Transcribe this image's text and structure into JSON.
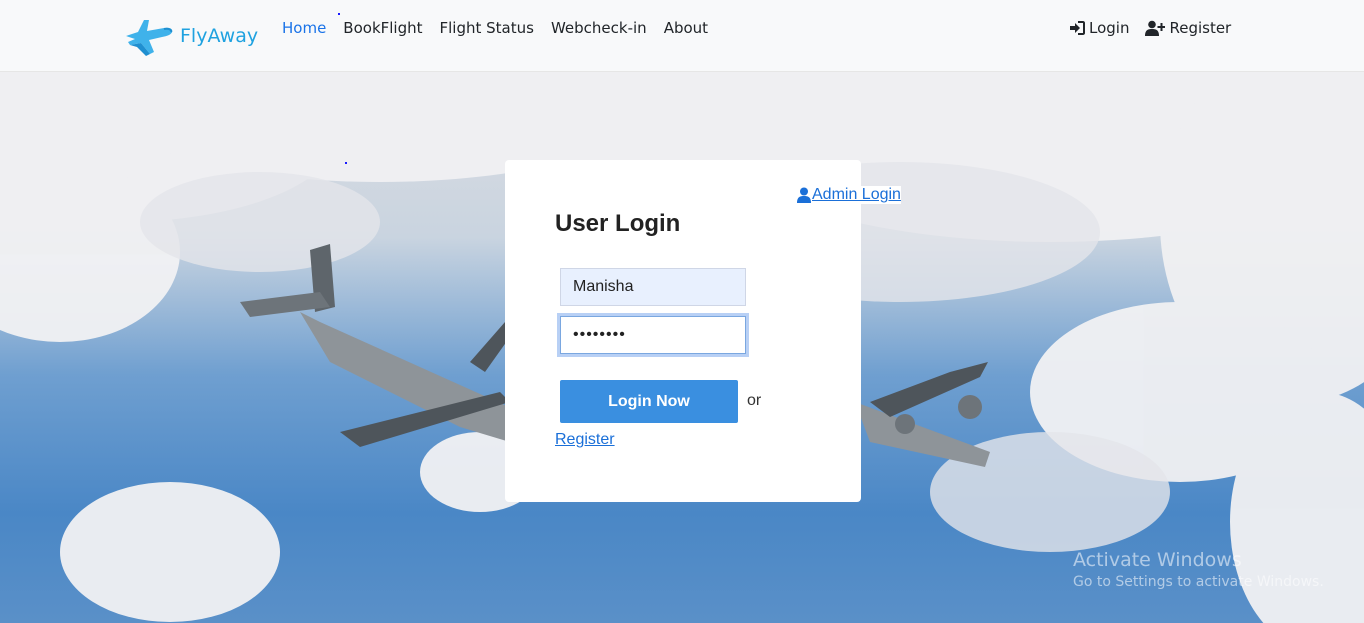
{
  "brand": {
    "name": "FlyAway",
    "icon": "airplane-logo"
  },
  "nav": {
    "links": [
      "Home",
      "BookFlight",
      "Flight Status",
      "Webcheck-in",
      "About"
    ],
    "active": "Home",
    "right": {
      "login_label": "Login",
      "register_label": "Register",
      "login_icon": "sign-in-icon",
      "register_icon": "user-plus-icon"
    }
  },
  "login_card": {
    "admin_link": "Admin Login",
    "admin_icon": "user-icon",
    "title": "User Login",
    "username_value": "Manisha",
    "password_value": "••••••••",
    "submit_label": "Login Now",
    "or_text": "or",
    "register_link": "Register"
  },
  "watermark": {
    "title": "Activate Windows",
    "subtitle": "Go to Settings to activate Windows."
  },
  "colors": {
    "brand": "#1fa2e0",
    "active_link": "#1a73e8",
    "button": "#3a8fe0",
    "link": "#1a6fd8"
  }
}
